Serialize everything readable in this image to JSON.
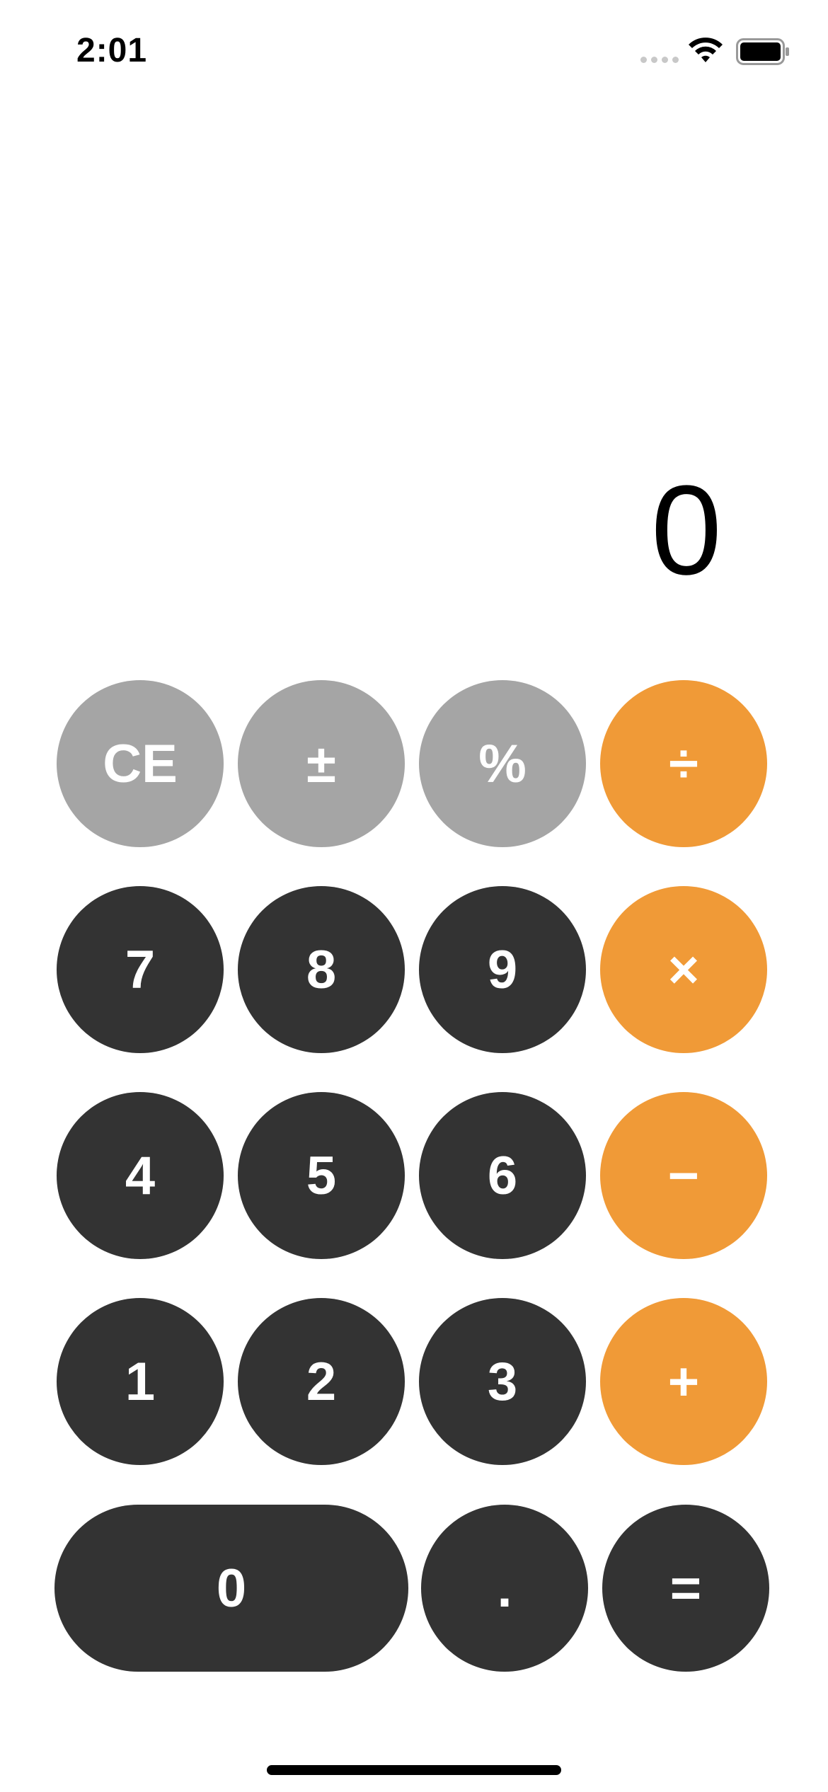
{
  "status_bar": {
    "time": "2:01",
    "wifi_icon": "wifi-icon",
    "battery_icon": "battery-full-icon"
  },
  "display": {
    "value": "0"
  },
  "keypad": {
    "row1": [
      "CE",
      "±",
      "%",
      "÷"
    ],
    "row2": [
      "7",
      "8",
      "9",
      "×"
    ],
    "row3": [
      "4",
      "5",
      "6",
      "−"
    ],
    "row4": [
      "1",
      "2",
      "3",
      "+"
    ],
    "row5": [
      "0",
      ".",
      "="
    ]
  },
  "colors": {
    "function_key": "#a5a5a5",
    "number_key": "#333333",
    "operator_key": "#f09a37",
    "key_text": "#ffffff",
    "background": "#ffffff"
  }
}
